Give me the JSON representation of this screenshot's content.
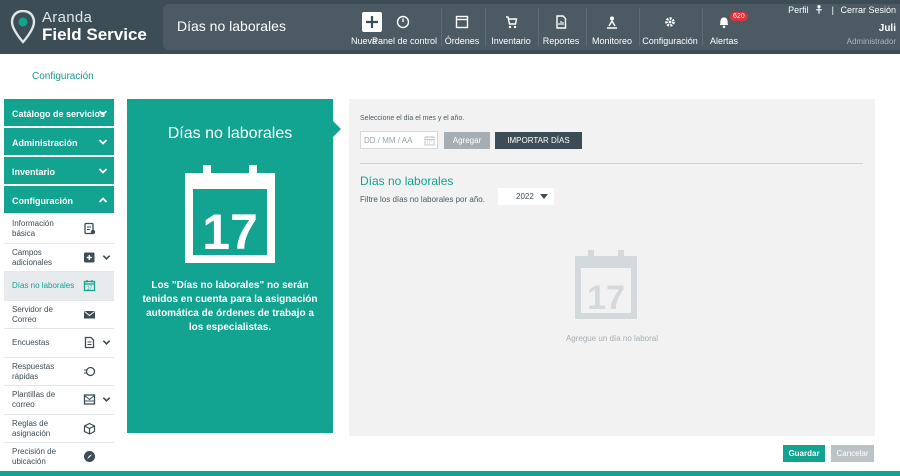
{
  "brand": {
    "line1": "Aranda",
    "line2": "Field Service"
  },
  "header": {
    "page_title": "Días no laborales"
  },
  "nav": {
    "new_label": "Nueva",
    "panel_label": "Panel de control",
    "orders_label": "Órdenes",
    "inventory_label": "Inventario",
    "reports_label": "Reportes",
    "monitor_label": "Monitoreo",
    "config_label": "Configuración",
    "alerts_label": "Alertas",
    "alerts_count": "620"
  },
  "user": {
    "profile_label": "Perfil",
    "separator": "|",
    "logout_label": "Cerrar Sesión",
    "name": "Juli",
    "role": "Administrador"
  },
  "breadcrumb": "Configuración",
  "sidebar": {
    "sections": [
      {
        "label": "Catálogo de servicios"
      },
      {
        "label": "Administración"
      },
      {
        "label": "Inventario"
      },
      {
        "label": "Configuración"
      }
    ],
    "items": [
      {
        "label": "Información básica",
        "icon": "checklist-icon"
      },
      {
        "label": "Campos adicionales",
        "icon": "add-box-icon"
      },
      {
        "label": "Días no laborales",
        "icon": "calendar-icon"
      },
      {
        "label": "Servidor de Correo",
        "icon": "mail-icon"
      },
      {
        "label": "Encuestas",
        "icon": "document-icon"
      },
      {
        "label": "Respuestas rápidas",
        "icon": "quick-reply-icon"
      },
      {
        "label": "Plantillas de correo",
        "icon": "mail-template-icon"
      },
      {
        "label": "Reglas de asignación",
        "icon": "cube-icon"
      },
      {
        "label": "Precisión de ubicación",
        "icon": "compass-icon"
      }
    ]
  },
  "info_card": {
    "title": "Días no laborales",
    "calendar_day": "17",
    "text": "Los \"Días no laborales\" no serán tenidos en cuenta para la asignación automática de órdenes de trabajo a los especialistas."
  },
  "main": {
    "date_label": "Seleccione el día el mes y el año.",
    "date_placeholder": "DD / MM / AA",
    "add_label": "Agregar",
    "import_label": "IMPORTAR DÍAS",
    "section_title": "Días no laborales",
    "filter_label": "Filtre los días no laborales por año.",
    "year": "2022",
    "empty_day": "17",
    "empty_text": "Agregue un día no laboral"
  },
  "actions": {
    "save_label": "Guardar",
    "cancel_label": "Cancelar"
  },
  "colors": {
    "accent": "#12a391",
    "header": "#3d4d56",
    "alert": "#e0323c"
  }
}
